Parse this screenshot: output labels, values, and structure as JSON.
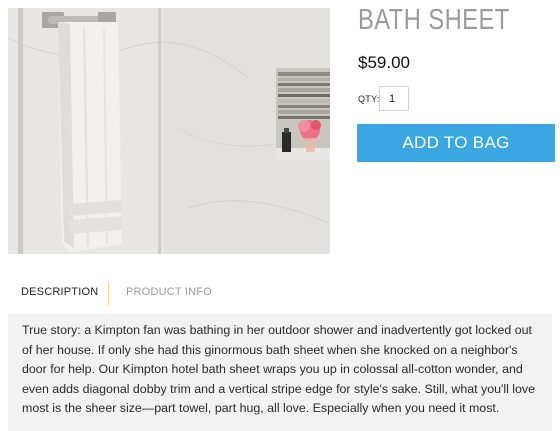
{
  "product": {
    "title": "BATH SHEET",
    "price": "$59.00",
    "qty_label": "QTY:",
    "qty_value": "1",
    "add_to_bag_label": "ADD TO BAG"
  },
  "tabs": [
    {
      "label": "DESCRIPTION",
      "active": true
    },
    {
      "label": "PRODUCT INFO",
      "active": false
    }
  ],
  "description": "True story: a Kimpton fan was bathing in her outdoor shower and inadvertently got locked out of her house. If only she had this ginormous bath sheet when she knocked on a neighbor's door for help. Our Kimpton hotel bath sheet wraps you up in colossal all-cotton wonder, and even adds diagonal dobby trim and a vertical stripe edge for style's sake. Still, what you'll love most is the sheer size—part towel, part hug, all love. Especially when you need it most.",
  "colors": {
    "accent_button": "#3aa6e2",
    "title_gray": "#9b9b9b",
    "tab_divider": "#f2d58a",
    "panel_bg": "#f2f2f2"
  },
  "icons": {
    "photo": "towel-on-rack-photo"
  }
}
